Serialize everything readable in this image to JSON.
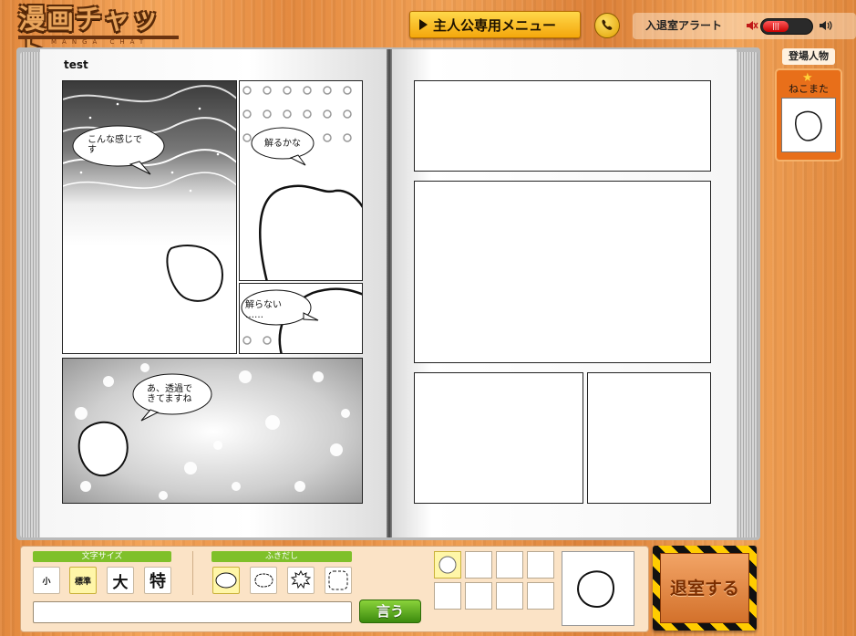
{
  "app": {
    "logo_text": "漫画チャット",
    "logo_subtitle": "MANGA CHAT"
  },
  "header": {
    "menu_button": "主人公専用メニュー",
    "alert_label": "入退室アラート",
    "alert_toggle": "|||"
  },
  "book": {
    "page_title": "test",
    "bubbles": {
      "b1": [
        "こんな感じで",
        "す"
      ],
      "b2": "解るかな",
      "b3": [
        "解らない",
        "……"
      ],
      "b4": [
        "あ、透過で",
        "きてますね"
      ]
    }
  },
  "characters": {
    "label": "登場人物",
    "items": [
      {
        "name": "ねこまた",
        "icon": "face-icon"
      }
    ]
  },
  "toolbar": {
    "font_size_label": "文字サイズ",
    "sizes": [
      "小",
      "標準",
      "大",
      "特"
    ],
    "selected_size": "標準",
    "bubble_label": "ふきだし",
    "bubble_styles": [
      "oval-bubble-icon",
      "cloud-bubble-icon",
      "shout-bubble-icon",
      "dashed-bubble-icon"
    ],
    "message_input": {
      "value": "",
      "placeholder": ""
    },
    "say_button": "言う"
  },
  "exit_button": "退室する",
  "colors": {
    "accent": "#f4a70c",
    "green": "#7fc02a",
    "active": "#fff6a8"
  }
}
